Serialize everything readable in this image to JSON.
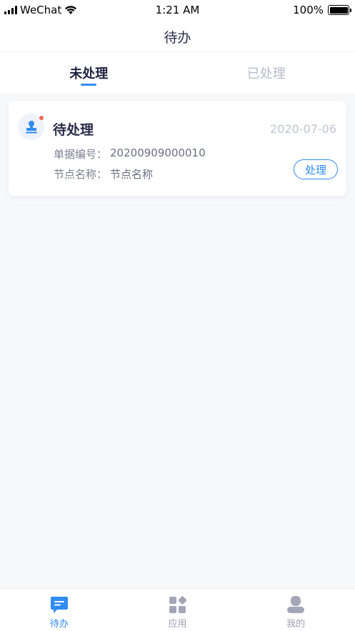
{
  "status_bar": {
    "carrier": "WeChat",
    "time": "1:21 AM",
    "battery": "100%"
  },
  "nav": {
    "title": "待办"
  },
  "tabs": [
    {
      "label": "未处理",
      "active": true
    },
    {
      "label": "已处理",
      "active": false
    }
  ],
  "card": {
    "title": "待处理",
    "date": "2020-07-06",
    "doc_number_label": "单据编号：",
    "doc_number": "20200909000010",
    "node_name_label": "节点名称：",
    "node_name": "节点名称",
    "action_label": "处理"
  },
  "tab_bar": [
    {
      "label": "待办",
      "icon": "todo-icon",
      "active": true
    },
    {
      "label": "应用",
      "icon": "apps-icon",
      "active": false
    },
    {
      "label": "我的",
      "icon": "profile-icon",
      "active": false
    }
  ],
  "colors": {
    "accent": "#2f8cf0",
    "unread_dot": "#f06a4f",
    "inactive": "#9ea1b0"
  }
}
